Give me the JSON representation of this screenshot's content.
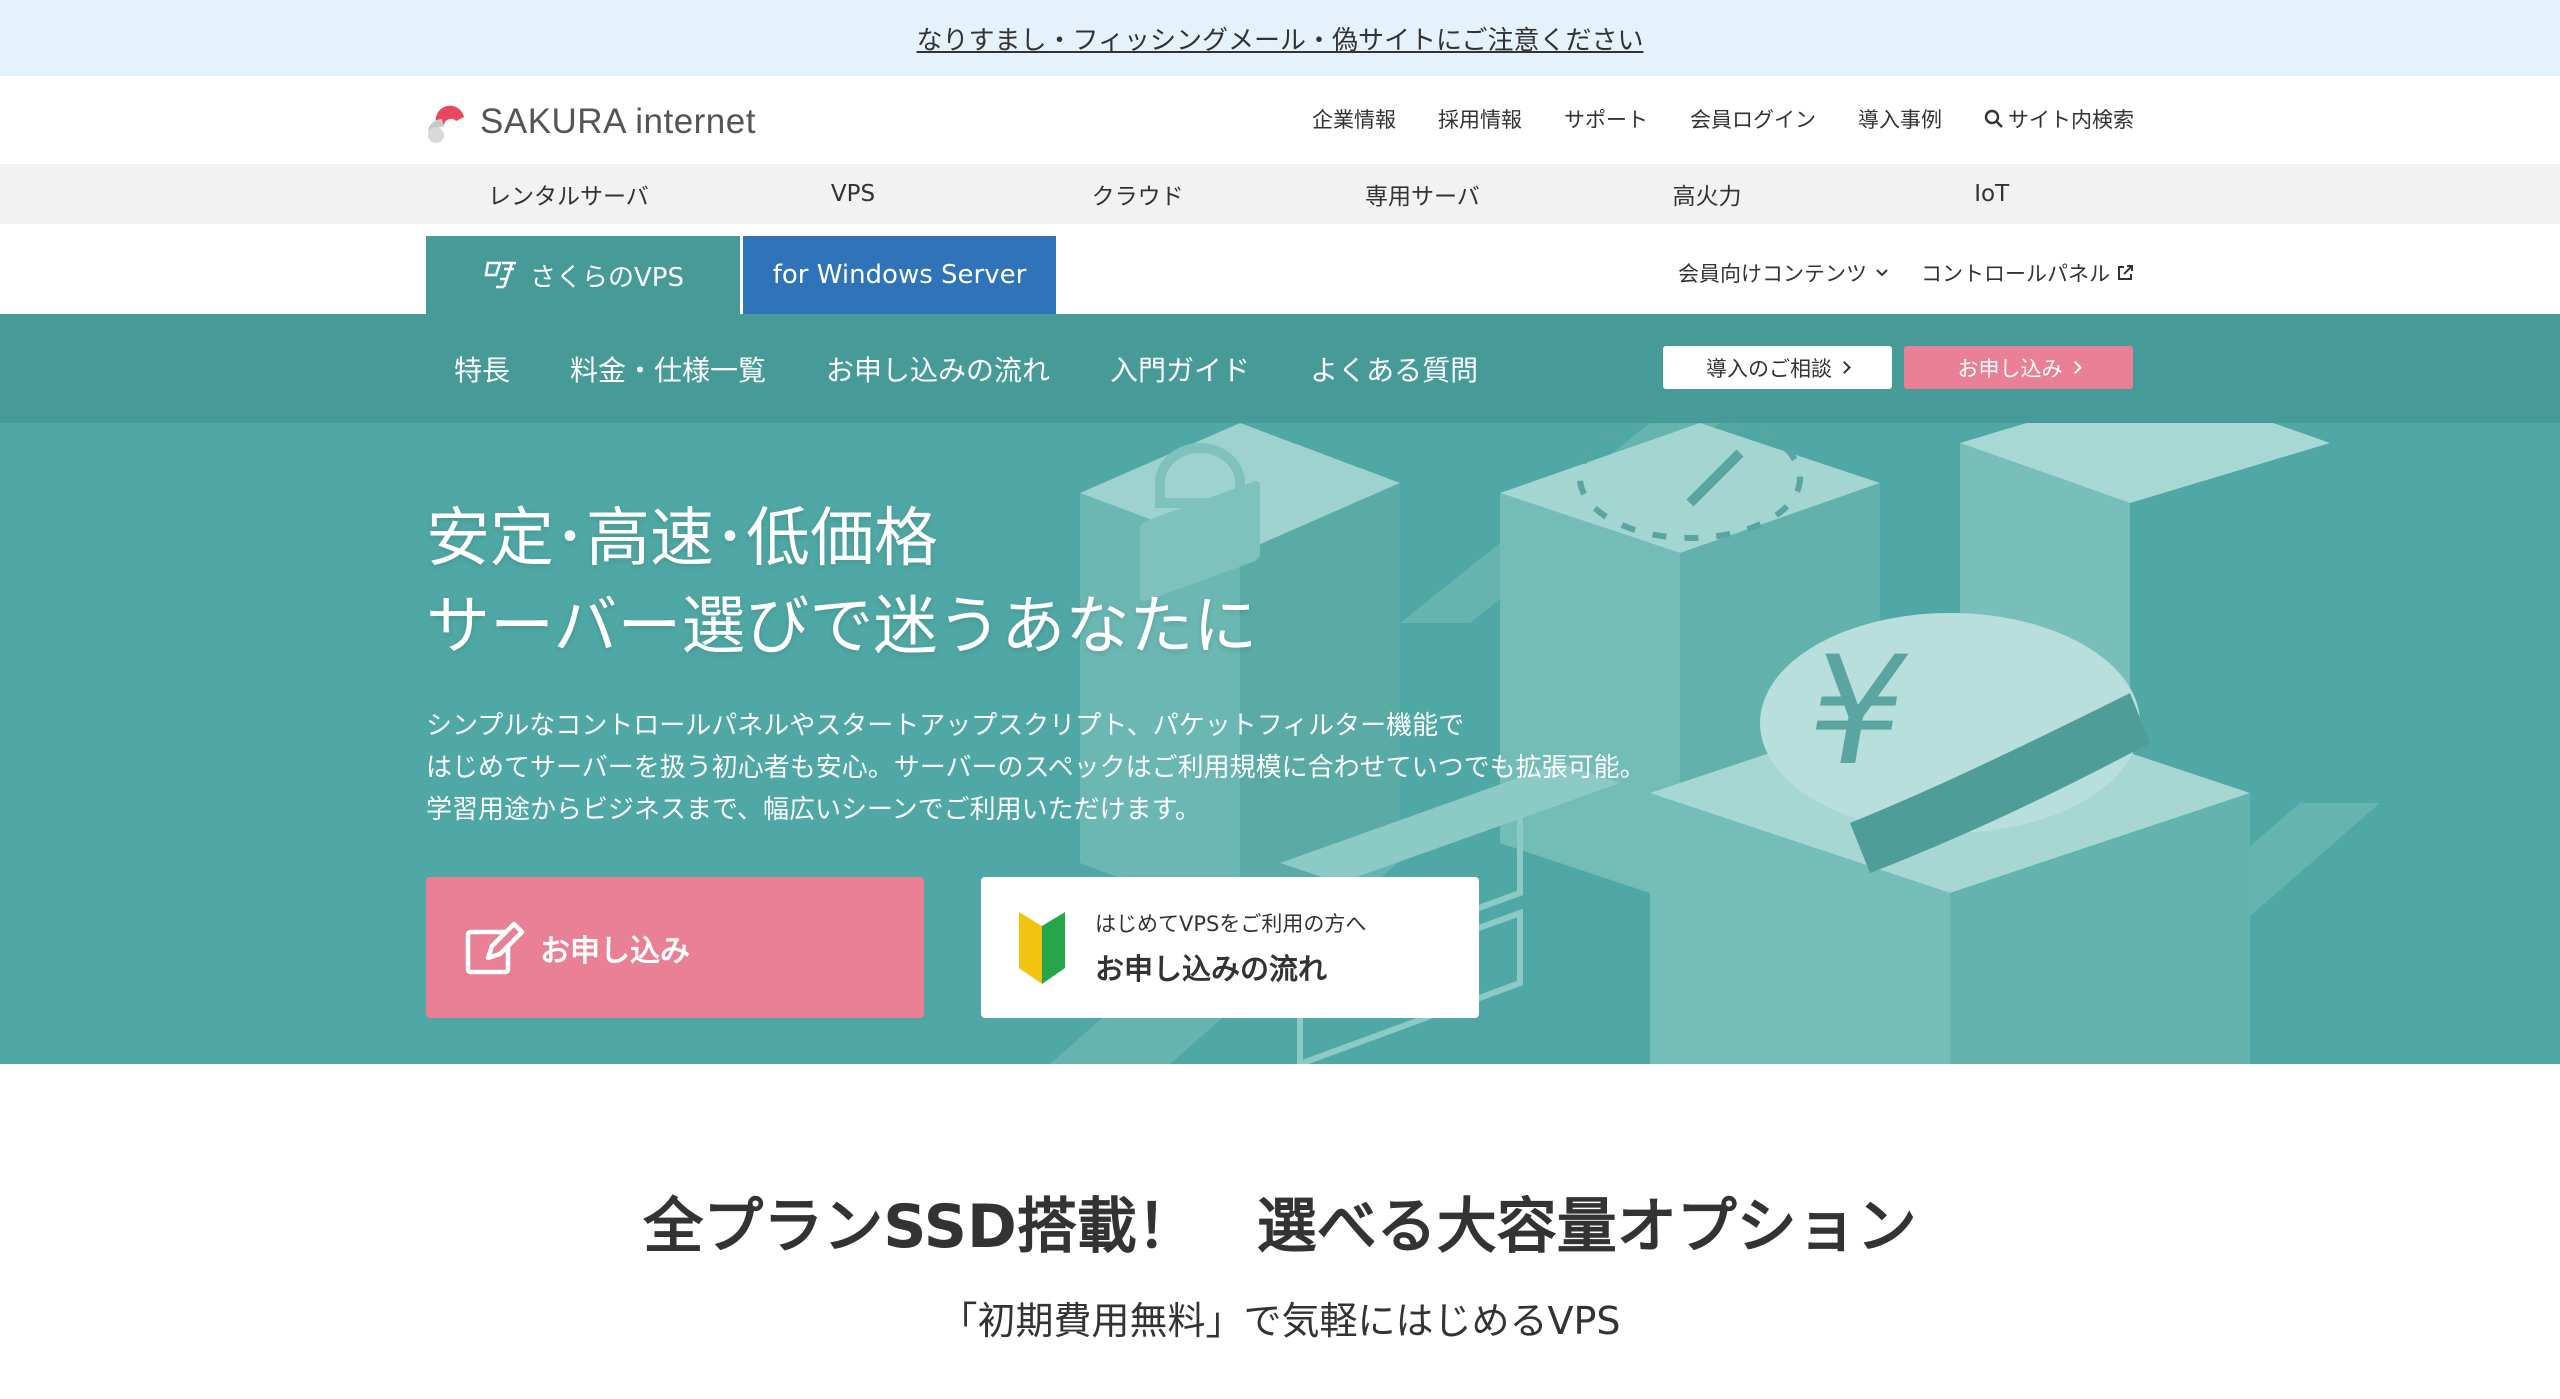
{
  "alert": {
    "text": "なりすまし・フィッシングメール・偽サイトにご注意ください"
  },
  "header": {
    "logo_text": "SAKURA internet",
    "links": [
      "企業情報",
      "採用情報",
      "サポート",
      "会員ログイン",
      "導入事例",
      "サイト内検索"
    ]
  },
  "global_nav": [
    "レンタルサーバ",
    "VPS",
    "クラウド",
    "専用サーバ",
    "高火力",
    "IoT"
  ],
  "product": {
    "tab_vps": "さくらのVPS",
    "tab_windows": "for Windows Server",
    "member_contents": "会員向けコンテンツ",
    "control_panel": "コントロールパネル"
  },
  "sub_nav": {
    "items": [
      "特長",
      "料金・仕様一覧",
      "お申し込みの流れ",
      "入門ガイド",
      "よくある質問"
    ],
    "consult_button": "導入のご相談",
    "apply_button": "お申し込み"
  },
  "hero": {
    "title_line1": "安定･高速･低価格",
    "title_line2": "サーバー選びで迷うあなたに",
    "desc_line1": "シンプルなコントロールパネルやスタートアップスクリプト、パケットフィルター機能で",
    "desc_line2": "はじめてサーバーを扱う初心者も安心。サーバーのスペックはご利用規模に合わせていつでも拡張可能。",
    "desc_line3": "学習用途からビジネスまで、幅広いシーンでご利用いただけます。",
    "cta_apply": "お申し込み",
    "cta_flow_small": "はじめてVPSをご利用の方へ",
    "cta_flow_big": "お申し込みの流れ"
  },
  "section": {
    "headline": "全プランSSD搭載！　選べる大容量オプション",
    "subline": "「初期費用無料」で気軽にはじめるVPS"
  },
  "colors": {
    "teal": "#469a98",
    "hero_teal": "#4fa8a5",
    "pink": "#e98095",
    "windows_blue": "#2f73b8",
    "alert_bg": "#e6f2fb"
  }
}
